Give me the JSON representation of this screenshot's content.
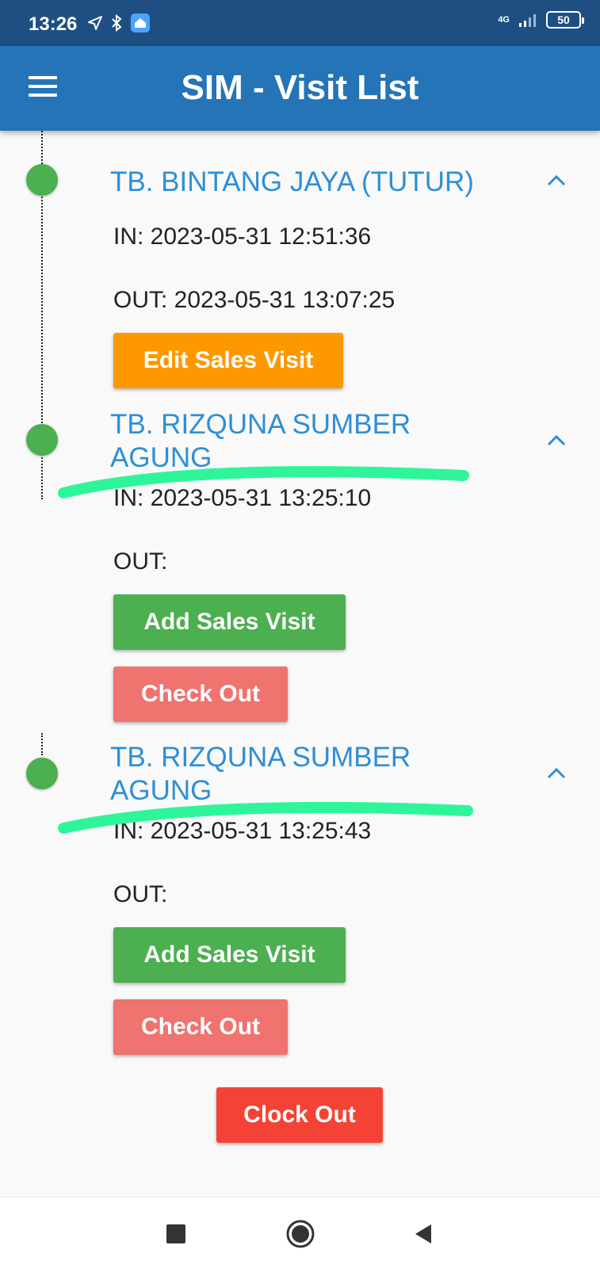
{
  "status_bar": {
    "time": "13:26",
    "icons": [
      "location-arrow-icon",
      "bluetooth-icon",
      "home-app-icon"
    ],
    "network": "4G",
    "battery": "50"
  },
  "app_bar": {
    "title": "SIM - Visit List",
    "menu_icon": "hamburger-menu-icon"
  },
  "visits": [
    {
      "title": "TB. BINTANG JAYA (TUTUR)",
      "in": "IN: 2023-05-31 12:51:36",
      "out": "OUT: 2023-05-31 13:07:25",
      "buttons": [
        "Edit Sales Visit"
      ]
    },
    {
      "title": "TB. RIZQUNA SUMBER AGUNG",
      "in": "IN: 2023-05-31 13:25:10",
      "out": "OUT:",
      "buttons": [
        "Add Sales Visit",
        "Check Out"
      ]
    },
    {
      "title": "TB. RIZQUNA SUMBER AGUNG",
      "in": "IN: 2023-05-31 13:25:43",
      "out": "OUT:",
      "buttons": [
        "Add Sales Visit",
        "Check Out"
      ]
    }
  ],
  "clock_out_label": "Clock Out",
  "colors": {
    "app_bar": "#2574b7",
    "status_bar": "#1f4f82",
    "title_blue": "#2e8fd6",
    "dot_green": "#4caf50",
    "edit_orange": "#fe9800",
    "add_green": "#4caf50",
    "checkout_salmon": "#ef736f",
    "clockout_red": "#f44336",
    "highlight_mark": "#2ff59a"
  },
  "nav_bar": {
    "icons": [
      "recent-apps-icon",
      "home-icon",
      "back-icon"
    ]
  }
}
